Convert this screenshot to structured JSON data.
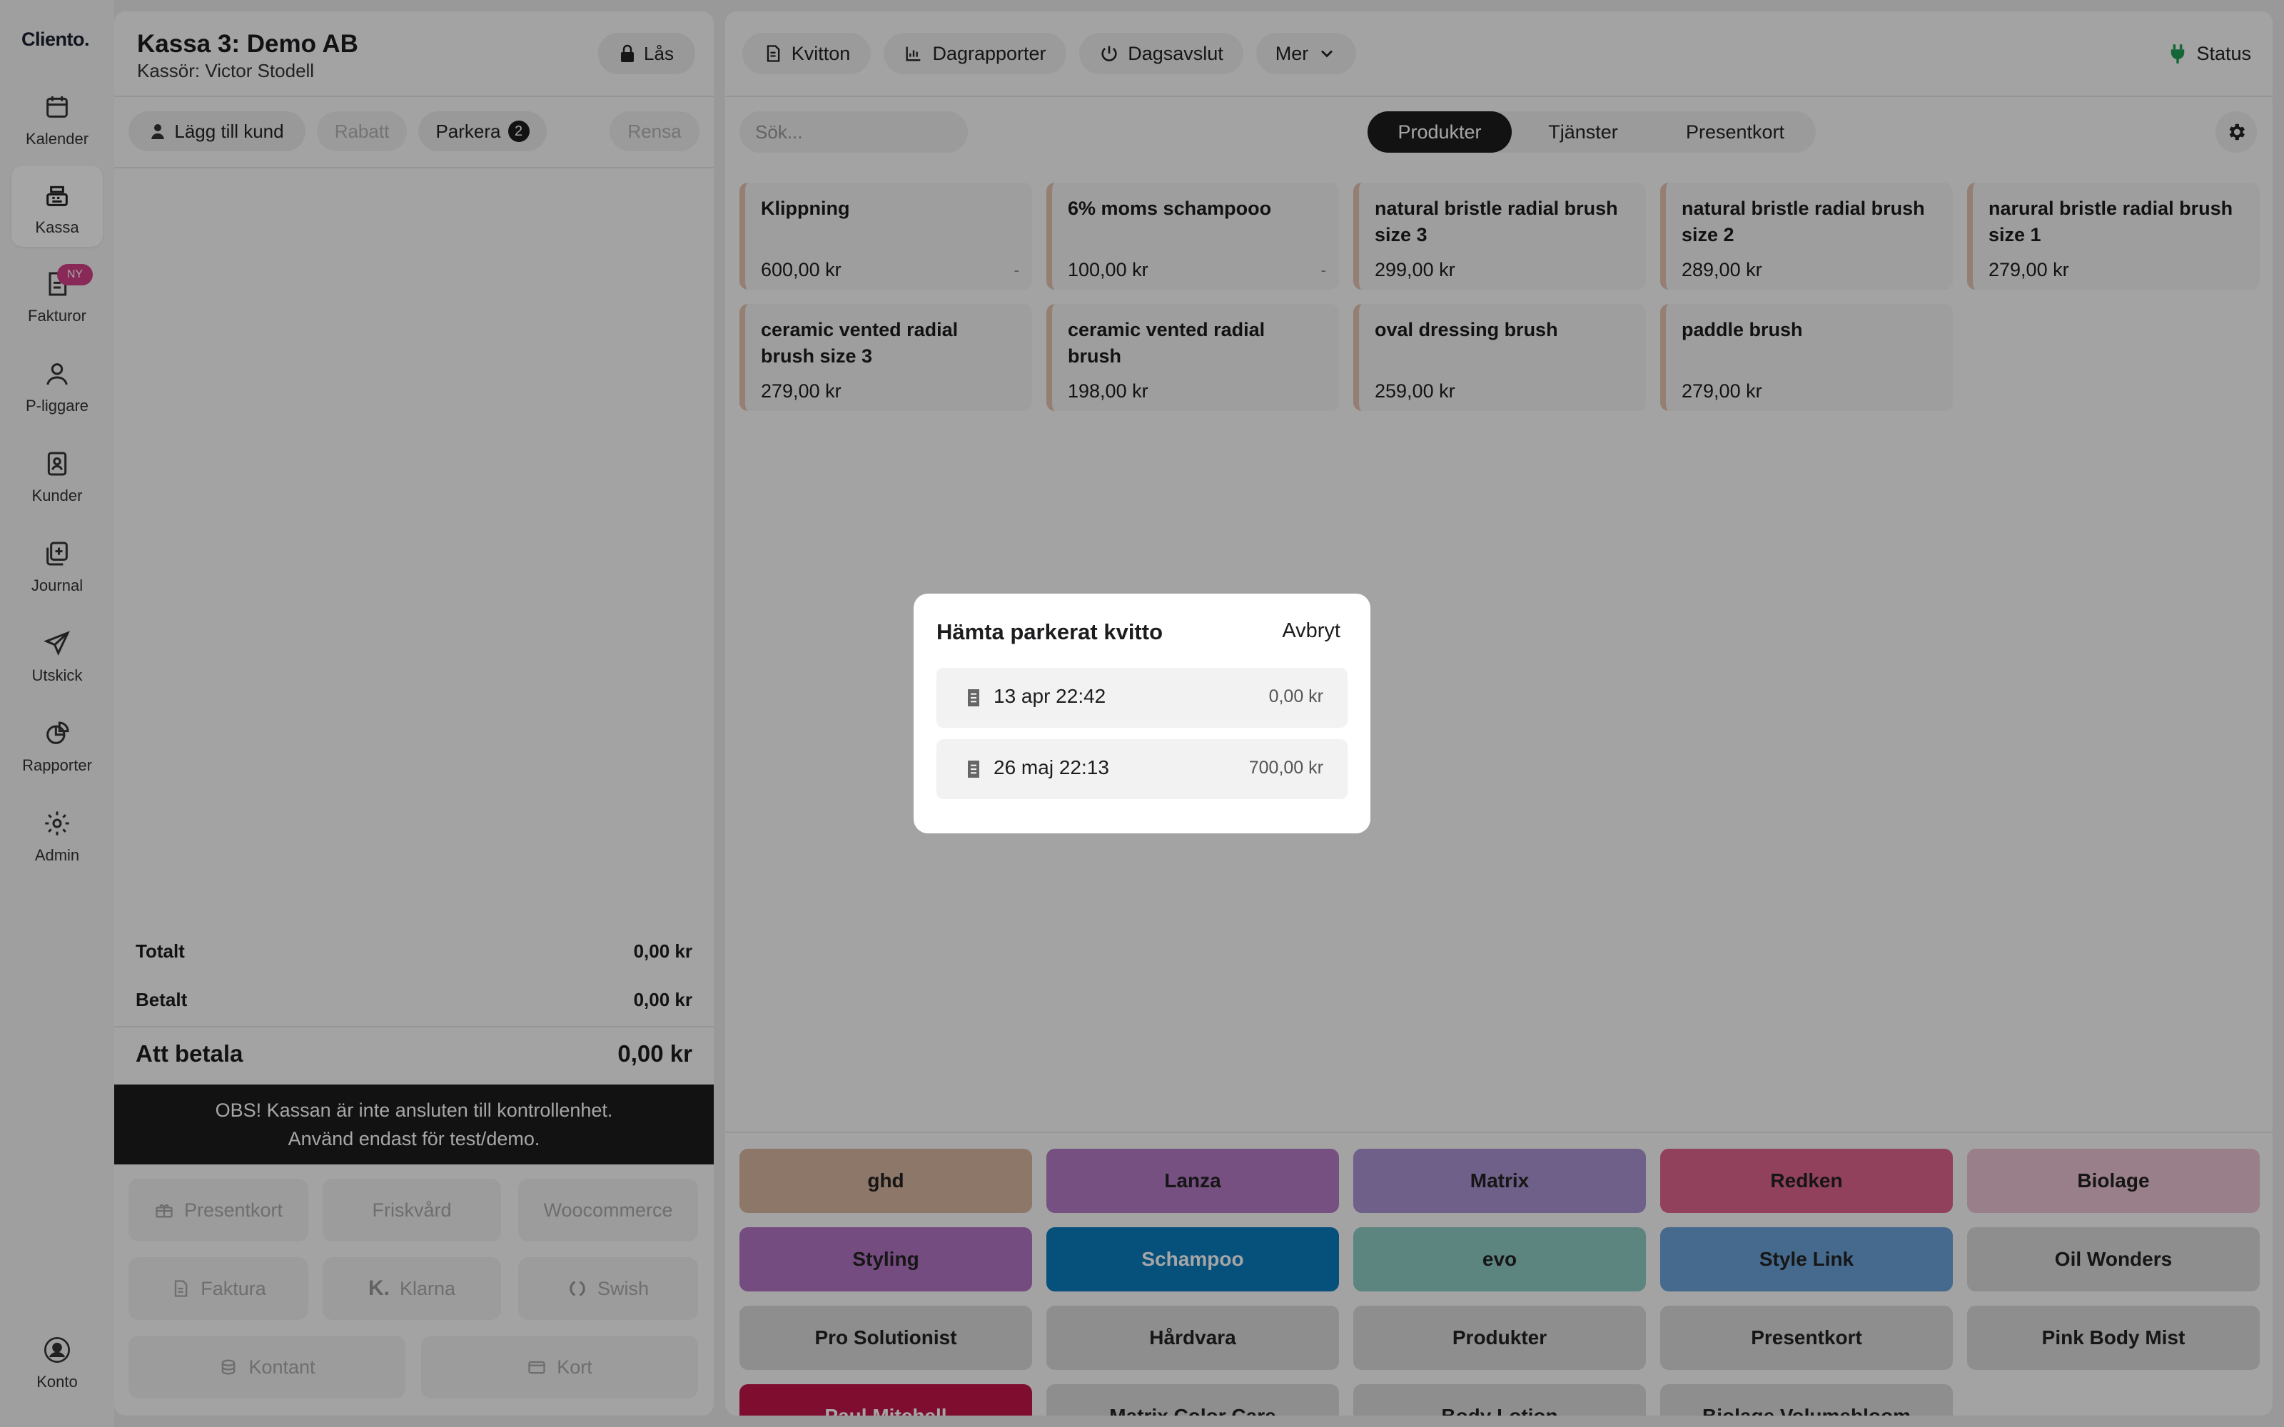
{
  "app": {
    "logo": "Cliento."
  },
  "nav": {
    "items": [
      {
        "label": "Kalender",
        "icon": "calendar-icon"
      },
      {
        "label": "Kassa",
        "icon": "register-icon",
        "active": true
      },
      {
        "label": "Fakturor",
        "icon": "invoice-icon",
        "badge": "NY"
      },
      {
        "label": "P-liggare",
        "icon": "person-icon"
      },
      {
        "label": "Kunder",
        "icon": "contacts-icon"
      },
      {
        "label": "Journal",
        "icon": "journal-icon"
      },
      {
        "label": "Utskick",
        "icon": "send-icon"
      },
      {
        "label": "Rapporter",
        "icon": "chart-icon"
      },
      {
        "label": "Admin",
        "icon": "gear-icon"
      }
    ],
    "account": "Konto"
  },
  "register": {
    "title": "Kassa 3: Demo AB",
    "cashier": "Kassör: Victor Stodell",
    "lock": "Lås",
    "add_customer": "Lägg till kund",
    "discount": "Rabatt",
    "park": "Parkera",
    "park_count": "2",
    "clear": "Rensa"
  },
  "totals": {
    "total_label": "Totalt",
    "total": "0,00 kr",
    "paid_label": "Betalt",
    "paid": "0,00 kr",
    "due_label": "Att betala",
    "due": "0,00 kr"
  },
  "warning": {
    "line1": "OBS! Kassan är inte ansluten till kontrollenhet.",
    "line2": "Använd endast för test/demo."
  },
  "payments": [
    "Presentkort",
    "Friskvård",
    "Woocommerce",
    "Faktura",
    "Klarna",
    "Swish",
    "Kontant",
    "Kort"
  ],
  "toolbar": {
    "receipts": "Kvitton",
    "daily_reports": "Dagrapporter",
    "day_close": "Dagsavslut",
    "more": "Mer",
    "status": "Status"
  },
  "search": {
    "placeholder": "Sök..."
  },
  "tabs": [
    "Produkter",
    "Tjänster",
    "Presentkort"
  ],
  "products": [
    {
      "name": "Klippning",
      "price": "600,00 kr",
      "dash": "-"
    },
    {
      "name": "6% moms schampooo",
      "price": "100,00 kr",
      "dash": "-"
    },
    {
      "name": "natural bristle radial brush size 3",
      "price": "299,00 kr"
    },
    {
      "name": "natural bristle radial brush size 2",
      "price": "289,00 kr"
    },
    {
      "name": "narural bristle radial brush size 1",
      "price": "279,00 kr"
    },
    {
      "name": "ceramic vented radial brush size 3",
      "price": "279,00 kr"
    },
    {
      "name": "ceramic vented radial brush",
      "price": "198,00 kr"
    },
    {
      "name": "oval dressing brush",
      "price": "259,00 kr"
    },
    {
      "name": "paddle brush",
      "price": "279,00 kr"
    }
  ],
  "categories": [
    {
      "label": "ghd",
      "color": "#d9b7a0"
    },
    {
      "label": "Lanza",
      "color": "#b57cc7"
    },
    {
      "label": "Matrix",
      "color": "#a994d2"
    },
    {
      "label": "Redken",
      "color": "#e0658e"
    },
    {
      "label": "Biolage",
      "color": "#ecc4d4"
    },
    {
      "label": "Styling",
      "color": "#b276c4"
    },
    {
      "label": "Schampoo",
      "color": "#0a7bbf"
    },
    {
      "label": "evo",
      "color": "#8fcdc5"
    },
    {
      "label": "Style Link",
      "color": "#6aa3da"
    },
    {
      "label": "Oil Wonders",
      "color": "#dadada"
    },
    {
      "label": "Pro Solutionist",
      "color": "#dadada"
    },
    {
      "label": "Hårdvara",
      "color": "#dadada"
    },
    {
      "label": "Produkter",
      "color": "#dadada"
    },
    {
      "label": "Presentkort",
      "color": "#dadada"
    },
    {
      "label": "Pink Body Mist",
      "color": "#dadada"
    },
    {
      "label": "Paul Mitchell",
      "color": "#c2154a"
    },
    {
      "label": "Matrix Color Care",
      "color": "#dadada"
    },
    {
      "label": "Body Lotion",
      "color": "#dadada"
    },
    {
      "label": "Biolage Volumebloom",
      "color": "#dadada"
    }
  ],
  "modal": {
    "title": "Hämta parkerat kvitto",
    "cancel": "Avbryt",
    "receipts": [
      {
        "date": "13 apr 22:42",
        "amount": "0,00 kr"
      },
      {
        "date": "26 maj 22:13",
        "amount": "700,00 kr"
      }
    ]
  }
}
